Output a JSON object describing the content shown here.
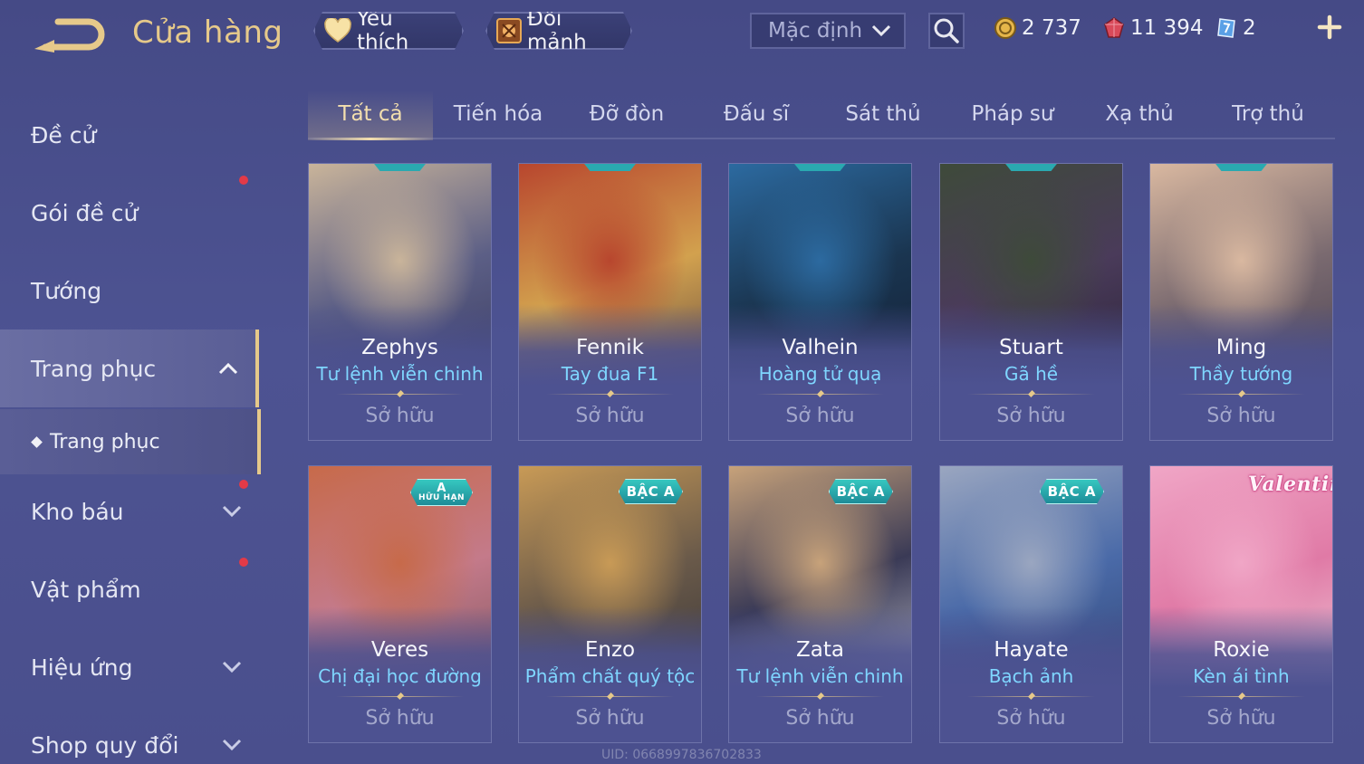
{
  "header": {
    "title": "Cửa hàng",
    "favorites_label": "Yêu thích",
    "exchange_label": "Đổi mảnh",
    "sort_value": "Mặc định",
    "currencies": {
      "gold": "2 737",
      "vouchers": "11 394",
      "tickets": "2"
    }
  },
  "sidebar": {
    "items": [
      {
        "label": "Đề cử"
      },
      {
        "label": "Gói đề cử"
      },
      {
        "label": "Tướng"
      },
      {
        "label": "Trang phục"
      },
      {
        "label": "Kho báu"
      },
      {
        "label": "Vật phẩm"
      },
      {
        "label": "Hiệu ứng"
      },
      {
        "label": "Shop quy đổi"
      }
    ],
    "sub_item": "Trang phục"
  },
  "tabs": [
    "Tất cả",
    "Tiến hóa",
    "Đỡ đòn",
    "Đấu sĩ",
    "Sát thủ",
    "Pháp sư",
    "Xạ thủ",
    "Trợ thủ"
  ],
  "cards": [
    {
      "hero": "Zephys",
      "skin": "Tư lệnh viễn chinh",
      "status": "Sở hữu",
      "art": [
        "#c9b49a",
        "#5c5f86",
        "#2d2e52"
      ]
    },
    {
      "hero": "Fennik",
      "skin": "Tay đua F1",
      "status": "Sở hữu",
      "art": [
        "#b8462e",
        "#d2a14e",
        "#3d2e3e"
      ]
    },
    {
      "hero": "Valhein",
      "skin": "Hoàng tử quạ",
      "status": "Sở hữu",
      "art": [
        "#2c6aa0",
        "#1a3550",
        "#10182c"
      ]
    },
    {
      "hero": "Stuart",
      "skin": "Gã hề",
      "status": "Sở hữu",
      "art": [
        "#3e4a3a",
        "#4a3b5a",
        "#201a2c"
      ]
    },
    {
      "hero": "Ming",
      "skin": "Thầy tướng",
      "status": "Sở hữu",
      "art": [
        "#d9b8a0",
        "#7a6a70",
        "#3a3448"
      ]
    },
    {
      "hero": "Veres",
      "skin": "Chị đại học đường",
      "status": "Sở hữu",
      "art": [
        "#c76a4a",
        "#c47a8a",
        "#6b4a52"
      ],
      "badge": "A",
      "badge_sub": "HỮU HẠN"
    },
    {
      "hero": "Enzo",
      "skin": "Phẩm chất quý tộc",
      "status": "Sở hữu",
      "art": [
        "#c89a56",
        "#6a5a4a",
        "#2a2a30"
      ],
      "badge": "BẬC A"
    },
    {
      "hero": "Zata",
      "skin": "Tư lệnh viễn chinh",
      "status": "Sở hữu",
      "art": [
        "#c7a27a",
        "#3a3a56",
        "#e2e2ea"
      ],
      "badge": "BẬC A"
    },
    {
      "hero": "Hayate",
      "skin": "Bạch ảnh",
      "status": "Sở hữu",
      "art": [
        "#9aa6c0",
        "#4a6aa8",
        "#2a3a66"
      ],
      "badge": "BẬC A"
    },
    {
      "hero": "Roxie",
      "skin": "Kèn ái tình",
      "status": "Sở hữu",
      "art": [
        "#f0a6c6",
        "#e07aa6",
        "#f4e6ea"
      ],
      "badge": "Valentine"
    }
  ],
  "watermark": "UID: 0668997836702833"
}
